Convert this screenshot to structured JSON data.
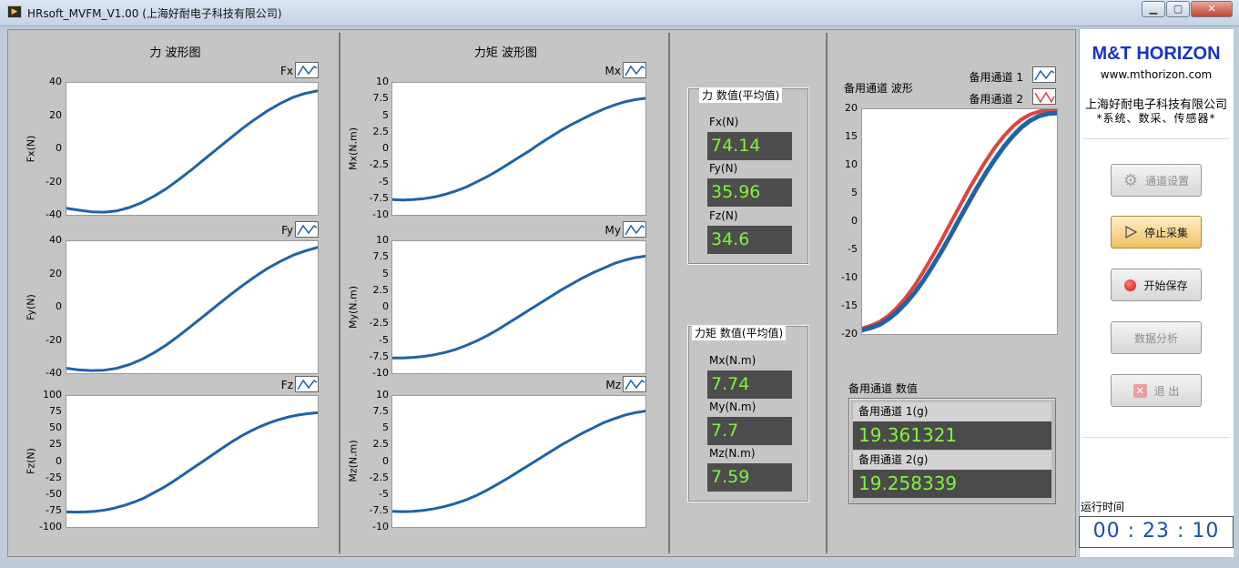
{
  "window": {
    "title": "HRsoft_MVFM_V1.00 (上海好耐电子科技有限公司)",
    "min_icon": "minimize-icon",
    "max_icon": "maximize-icon",
    "close_icon": "close-icon"
  },
  "force_panel": {
    "title": "力 波形图",
    "charts": [
      {
        "legend": "Fx",
        "ylabel": "Fx(N)",
        "ticks": [
          "40",
          "20",
          "0",
          "-20",
          "-40"
        ],
        "ylim": [
          -40,
          40
        ],
        "series": [
          -36,
          -37.2,
          -38.2,
          -38.4,
          -37.6,
          -35.6,
          -32.6,
          -28.6,
          -23.9,
          -18.3,
          -12.4,
          -6.2,
          0,
          6.2,
          12.3,
          17.9,
          23,
          27.4,
          31.1,
          33.6,
          35.2
        ]
      },
      {
        "legend": "Fy",
        "ylabel": "Fy(N)",
        "ticks": [
          "40",
          "20",
          "0",
          "-20",
          "-40"
        ],
        "ylim": [
          -40,
          40
        ],
        "series": [
          -37,
          -38,
          -38.4,
          -38.2,
          -37,
          -34.8,
          -31.6,
          -27.5,
          -22.6,
          -17,
          -11,
          -4.9,
          1.2,
          7.3,
          13.1,
          18.5,
          23.5,
          27.7,
          31.4,
          34.1,
          36.3
        ]
      },
      {
        "legend": "Fz",
        "ylabel": "Fz(N)",
        "ticks": [
          "100",
          "75",
          "50",
          "25",
          "0",
          "-25",
          "-50",
          "-75",
          "-100"
        ],
        "ylim": [
          -100,
          100
        ],
        "series": [
          -77,
          -77.2,
          -77,
          -76,
          -74,
          -71,
          -67,
          -62,
          -56,
          -48,
          -40,
          -31,
          -21,
          -11,
          -1,
          9,
          19,
          29,
          38,
          46,
          53,
          59,
          64,
          68,
          71,
          73,
          74.5
        ]
      }
    ]
  },
  "moment_panel": {
    "title": "力矩 波形图",
    "charts": [
      {
        "legend": "Mx",
        "ylabel": "Mx(N.m)",
        "ticks": [
          "10",
          "7.5",
          "5",
          "2.5",
          "0",
          "-2.5",
          "-5",
          "-7.5",
          "-10"
        ],
        "ylim": [
          -10,
          10
        ],
        "series": [
          -7.7,
          -7.75,
          -7.7,
          -7.55,
          -7.3,
          -6.9,
          -6.4,
          -5.8,
          -5.0,
          -4.2,
          -3.3,
          -2.3,
          -1.3,
          -0.3,
          0.8,
          1.8,
          2.8,
          3.7,
          4.5,
          5.3,
          6.0,
          6.6,
          7.1,
          7.45,
          7.65
        ]
      },
      {
        "legend": "My",
        "ylabel": "My(N.m)",
        "ticks": [
          "10",
          "7.5",
          "5",
          "2.5",
          "0",
          "-2.5",
          "-5",
          "-7.5",
          "-10"
        ],
        "ylim": [
          -10,
          10
        ],
        "series": [
          -7.7,
          -7.7,
          -7.6,
          -7.45,
          -7.2,
          -6.85,
          -6.4,
          -5.8,
          -5.1,
          -4.3,
          -3.4,
          -2.4,
          -1.4,
          -0.4,
          0.6,
          1.6,
          2.6,
          3.5,
          4.4,
          5.2,
          5.9,
          6.6,
          7.1,
          7.5,
          7.75
        ]
      },
      {
        "legend": "Mz",
        "ylabel": "Mz(N.m)",
        "ticks": [
          "10",
          "7.5",
          "5",
          "2.5",
          "0",
          "-2.5",
          "-5",
          "-7.5",
          "-10"
        ],
        "ylim": [
          -10,
          10
        ],
        "series": [
          -7.6,
          -7.65,
          -7.6,
          -7.45,
          -7.2,
          -6.85,
          -6.4,
          -5.85,
          -5.15,
          -4.35,
          -3.45,
          -2.5,
          -1.5,
          -0.5,
          0.5,
          1.5,
          2.5,
          3.4,
          4.3,
          5.1,
          5.9,
          6.5,
          7.05,
          7.45,
          7.7
        ]
      }
    ]
  },
  "force_values": {
    "title": "力 数值(平均值)",
    "fields": [
      {
        "label": "Fx(N)",
        "value": "74.14"
      },
      {
        "label": "Fy(N)",
        "value": "35.96"
      },
      {
        "label": "Fz(N)",
        "value": "34.6"
      }
    ]
  },
  "moment_values": {
    "title": "力矩 数值(平均值)",
    "fields": [
      {
        "label": "Mx(N.m)",
        "value": "7.74"
      },
      {
        "label": "My(N.m)",
        "value": "7.7"
      },
      {
        "label": "Mz(N.m)",
        "value": "7.59"
      }
    ]
  },
  "aux_chart": {
    "title": "备用通道  波形",
    "legend1": "备用通道 1",
    "legend2": "备用通道 2",
    "ticks": [
      "20",
      "15",
      "10",
      "5",
      "0",
      "-5",
      "-10",
      "-15",
      "-20"
    ],
    "ylim": [
      -20,
      20
    ],
    "colors": {
      "ch1": "#1f63a6",
      "ch2": "#e0433a"
    },
    "series1": [
      -19.3,
      -18.9,
      -18.3,
      -17.3,
      -16.0,
      -14.4,
      -12.5,
      -10.3,
      -7.8,
      -5.2,
      -2.4,
      0.5,
      3.3,
      6.1,
      8.7,
      11.1,
      13.3,
      15.2,
      16.8,
      18.0,
      18.8,
      19.2,
      19.3
    ],
    "series2": [
      -19.0,
      -18.5,
      -17.8,
      -16.7,
      -15.2,
      -13.4,
      -11.2,
      -8.7,
      -6.0,
      -3.2,
      -0.2,
      2.7,
      5.6,
      8.3,
      10.9,
      13.2,
      15.2,
      16.9,
      18.2,
      19.1,
      19.6,
      19.9,
      20.0
    ]
  },
  "aux_values": {
    "title": "备用通道  数值",
    "rows": [
      {
        "label": "备用通道 1(g)",
        "value": "19.361321"
      },
      {
        "label": "备用通道 2(g)",
        "value": "19.258339"
      }
    ]
  },
  "brand": {
    "name": "M&T HORIZON",
    "url": "www.mthorizon.com",
    "company": "上海好耐电子科技有限公司",
    "slogan": "*系统、数采、传感器*"
  },
  "buttons": {
    "channel_settings": "通道设置",
    "stop_acq": "停止采集",
    "start_save": "开始保存",
    "data_analysis": "数据分析",
    "exit": "退  出"
  },
  "runtime": {
    "label": "运行时间",
    "value": "00 : 23 : 10"
  },
  "colors": {
    "trace": "#1f63a6",
    "readout_text": "#7ff53d",
    "readout_bg": "#4d4d4d",
    "brand": "#1733c7"
  }
}
